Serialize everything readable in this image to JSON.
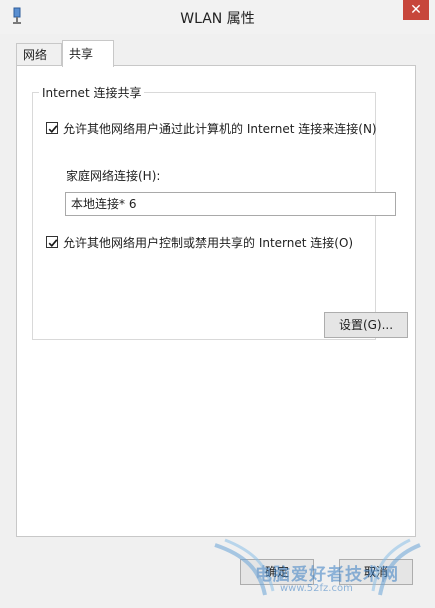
{
  "window": {
    "title": "WLAN 属性",
    "close_glyph": "✕"
  },
  "tabs": [
    {
      "label": "网络",
      "selected": false
    },
    {
      "label": "共享",
      "selected": true
    }
  ],
  "sharing": {
    "group_title": "Internet 连接共享",
    "allow_connect": {
      "label": "允许其他网络用户通过此计算机的 Internet 连接来连接(N)",
      "checked": true
    },
    "home_network_label": "家庭网络连接(H):",
    "home_network_value": "本地连接* 6",
    "allow_control": {
      "label": "允许其他网络用户控制或禁用共享的 Internet 连接(O)",
      "checked": true
    },
    "settings_button": "设置(G)..."
  },
  "footer": {
    "ok_label": "确定",
    "cancel_label": "取消"
  },
  "watermark": {
    "text": "电脑爱好者技术网",
    "url": "www.52fz.com"
  },
  "colors": {
    "close": "#c7463b",
    "check": "#1a1a1a"
  }
}
